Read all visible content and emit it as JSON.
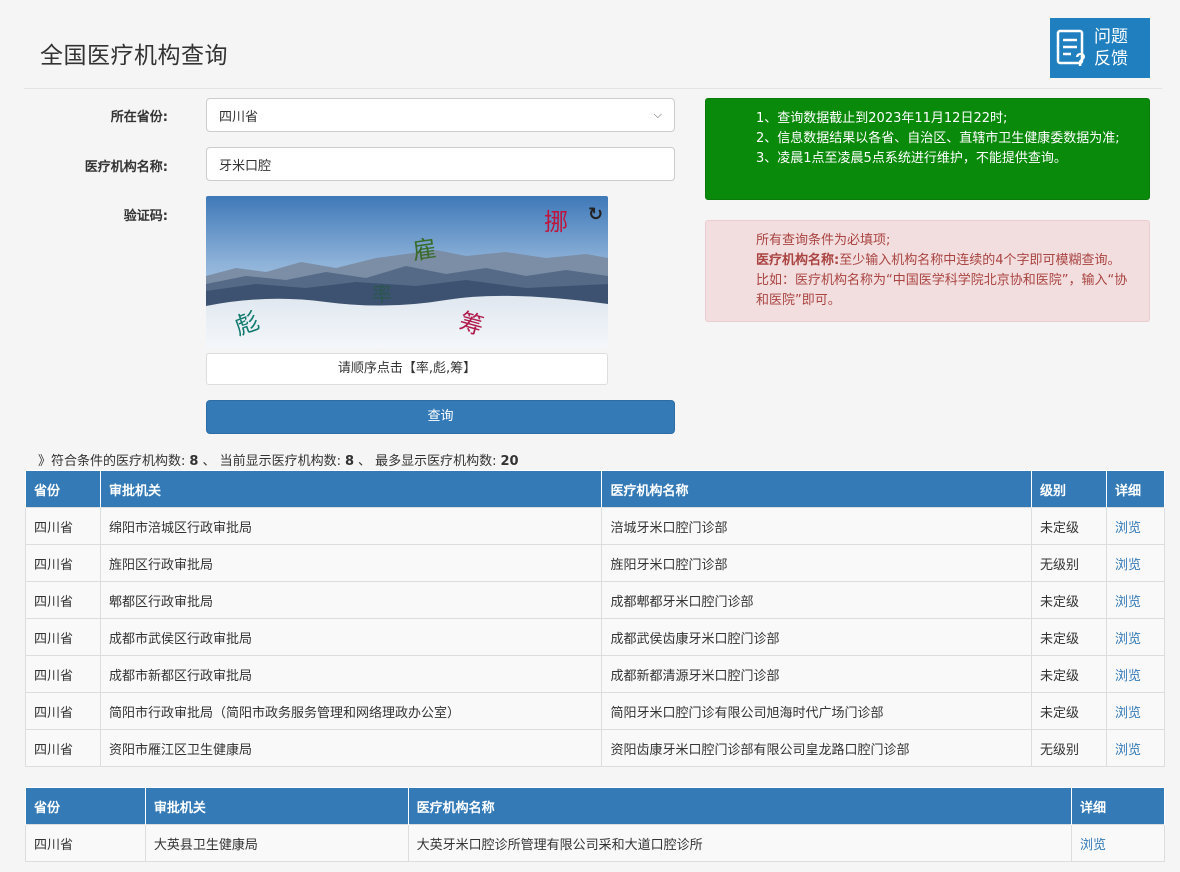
{
  "page": {
    "title": "全国医疗机构查询"
  },
  "feedback": {
    "line1": "问题",
    "line2": "反馈"
  },
  "form": {
    "province_label": "所在省份:",
    "province_value": "四川省",
    "name_label": "医疗机构名称:",
    "name_value": "牙米口腔",
    "captcha_label": "验证码:",
    "captcha_chars": [
      "挪",
      "雇",
      "率",
      "彪",
      "筹"
    ],
    "captcha_hint": "请顺序点击【率,彪,筹】",
    "query_label": "查询"
  },
  "notice": {
    "lines": [
      "1、查询数据截止到2023年11月12日22时;",
      "2、信息数据结果以各省、自治区、直辖市卫生健康委数据为准;",
      "3、凌晨1点至凌晨5点系统进行维护，不能提供查询。"
    ],
    "required": "所有查询条件为必填项;",
    "name_hint_label": "医疗机构名称:",
    "name_hint_text": "至少输入机构名称中连续的4个字即可模糊查询。比如：医疗机构名称为“中国医学科学院北京协和医院”，输入“协和医院”即可。"
  },
  "summary": {
    "prefix": "》符合条件的医疗机构数:",
    "matched": "8",
    "sep1": "、 当前显示医疗机构数:",
    "shown": "8",
    "sep2": "、 最多显示医疗机构数:",
    "max": "20"
  },
  "table1": {
    "headers": [
      "省份",
      "审批机关",
      "医疗机构名称",
      "级别",
      "详细"
    ],
    "rows": [
      [
        "四川省",
        "绵阳市涪城区行政审批局",
        "涪城牙米口腔门诊部",
        "未定级",
        "浏览"
      ],
      [
        "四川省",
        "旌阳区行政审批局",
        "旌阳牙米口腔门诊部",
        "无级别",
        "浏览"
      ],
      [
        "四川省",
        "郫都区行政审批局",
        "成都郫都牙米口腔门诊部",
        "未定级",
        "浏览"
      ],
      [
        "四川省",
        "成都市武侯区行政审批局",
        "成都武侯齿康牙米口腔门诊部",
        "未定级",
        "浏览"
      ],
      [
        "四川省",
        "成都市新都区行政审批局",
        "成都新都清源牙米口腔门诊部",
        "未定级",
        "浏览"
      ],
      [
        "四川省",
        "简阳市行政审批局（简阳市政务服务管理和网络理政办公室）",
        "简阳牙米口腔门诊有限公司旭海时代广场门诊部",
        "未定级",
        "浏览"
      ],
      [
        "四川省",
        "资阳市雁江区卫生健康局",
        "资阳齿康牙米口腔门诊部有限公司皇龙路口腔门诊部",
        "无级别",
        "浏览"
      ]
    ]
  },
  "table2": {
    "headers": [
      "省份",
      "审批机关",
      "医疗机构名称",
      "详细"
    ],
    "rows": [
      [
        "四川省",
        "大英县卫生健康局",
        "大英牙米口腔诊所管理有限公司采和大道口腔诊所",
        "浏览"
      ]
    ]
  },
  "colors": {
    "primary": "#337ab7",
    "notice_green": "#0a8a0a",
    "notice_red_bg": "#f2dede",
    "notice_red_text": "#a94442"
  }
}
